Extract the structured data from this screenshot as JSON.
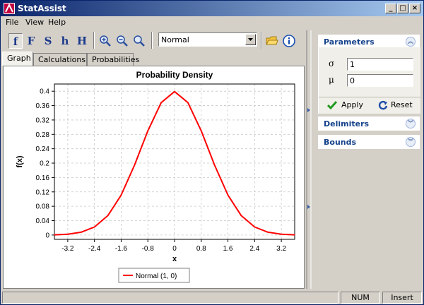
{
  "window": {
    "title": "StatAssist"
  },
  "menu": [
    "File",
    "View",
    "Help"
  ],
  "toolbar": {
    "functions": [
      "f",
      "F",
      "S",
      "h",
      "H"
    ],
    "distribution": "Normal"
  },
  "tabs": [
    "Graph",
    "Calculations",
    "Probabilities"
  ],
  "right_panel": {
    "parameters": {
      "title": "Parameters",
      "sigma_label": "σ",
      "sigma_value": "1",
      "mu_label": "μ",
      "mu_value": "0",
      "apply_label": "Apply",
      "reset_label": "Reset"
    },
    "delimiters_title": "Delimiters",
    "bounds_title": "Bounds"
  },
  "status": {
    "num": "NUM",
    "insert": "Insert"
  },
  "colors": {
    "curve": "#ff0000",
    "title_start": "#0a246a",
    "title_end": "#a6caf0",
    "panel_header_text": "#15428b"
  },
  "chart_data": {
    "type": "line",
    "title": "Probability Density",
    "xlabel": "x",
    "ylabel": "f(x)",
    "xlim": [
      -3.6,
      3.6
    ],
    "ylim": [
      -0.012,
      0.42
    ],
    "x_ticks": [
      "-3.2",
      "-2.4",
      "-1.6",
      "-0.8",
      "0",
      "0.8",
      "1.6",
      "2.4",
      "3.2"
    ],
    "y_ticks": [
      "0",
      "0.04",
      "0.08",
      "0.12",
      "0.16",
      "0.2",
      "0.24",
      "0.28",
      "0.32",
      "0.36",
      "0.4"
    ],
    "grid": true,
    "legend": "bottom-center",
    "series": [
      {
        "name": "Normal  (1,  0)",
        "color": "#ff0000",
        "x": [
          -3.6,
          -3.2,
          -2.8,
          -2.4,
          -2.0,
          -1.6,
          -1.2,
          -0.8,
          -0.4,
          0,
          0.4,
          0.8,
          1.2,
          1.6,
          2.0,
          2.4,
          2.8,
          3.2,
          3.6
        ],
        "y": [
          0.0006,
          0.0024,
          0.0079,
          0.0224,
          0.054,
          0.1109,
          0.1942,
          0.2897,
          0.3683,
          0.3989,
          0.3683,
          0.2897,
          0.1942,
          0.1109,
          0.054,
          0.0224,
          0.0079,
          0.0024,
          0.0006
        ]
      }
    ]
  }
}
